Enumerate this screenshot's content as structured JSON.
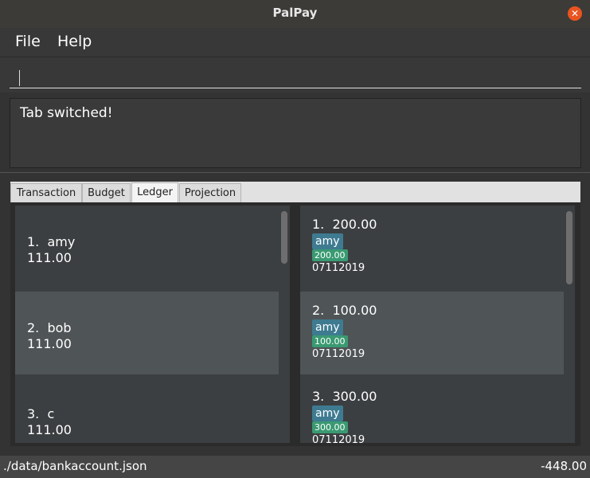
{
  "window": {
    "title": "PalPay",
    "close_icon": "close-icon"
  },
  "menu": {
    "file": "File",
    "help": "Help"
  },
  "command": {
    "value": ""
  },
  "result": {
    "message": "Tab switched!"
  },
  "tabs": [
    {
      "label": "Transaction",
      "active": false
    },
    {
      "label": "Budget",
      "active": false
    },
    {
      "label": "Ledger",
      "active": true
    },
    {
      "label": "Projection",
      "active": false
    }
  ],
  "people": [
    {
      "index": "1.",
      "name": "amy",
      "amount": "111.00",
      "selected": false
    },
    {
      "index": "2.",
      "name": "bob",
      "amount": "111.00",
      "selected": true
    },
    {
      "index": "3.",
      "name": "c",
      "amount": "111.00",
      "selected": false
    }
  ],
  "ledger": [
    {
      "index": "1.",
      "amount": "200.00",
      "person": "amy",
      "tag_amount": "200.00",
      "date": "07112019",
      "selected": false
    },
    {
      "index": "2.",
      "amount": "100.00",
      "person": "amy",
      "tag_amount": "100.00",
      "date": "07112019",
      "selected": true
    },
    {
      "index": "3.",
      "amount": "300.00",
      "person": "amy",
      "tag_amount": "300.00",
      "date": "07112019",
      "selected": false
    }
  ],
  "status": {
    "path": "./data/bankaccount.json",
    "balance": "-448.00"
  },
  "colors": {
    "accent": "#e95420",
    "tag_name": "#3e7b91",
    "tag_amount": "#3a9a72",
    "selected_row": "#4f5456"
  }
}
